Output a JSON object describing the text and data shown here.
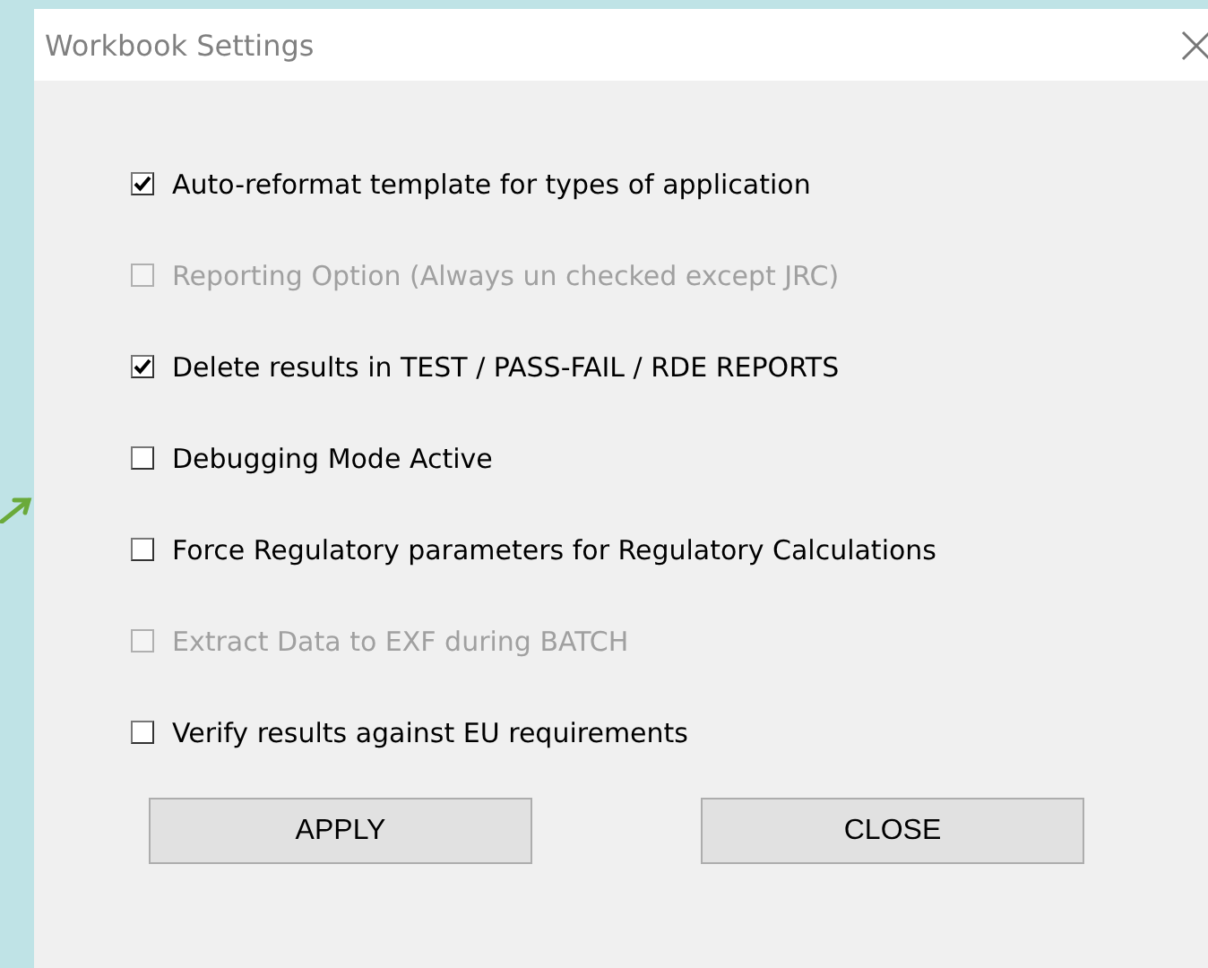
{
  "window": {
    "title": "Workbook Settings"
  },
  "options": [
    {
      "label": "Auto-reformat template for types of application",
      "checked": true,
      "disabled": false
    },
    {
      "label": "Reporting Option (Always un checked except JRC)",
      "checked": false,
      "disabled": true
    },
    {
      "label": "Delete results in TEST / PASS-FAIL / RDE REPORTS",
      "checked": true,
      "disabled": false
    },
    {
      "label": "Debugging Mode Active",
      "checked": false,
      "disabled": false
    },
    {
      "label": "Force Regulatory parameters for Regulatory Calculations",
      "checked": false,
      "disabled": false
    },
    {
      "label": "Extract Data to EXF during BATCH",
      "checked": false,
      "disabled": true
    },
    {
      "label": "Verify results against EU requirements",
      "checked": false,
      "disabled": false
    }
  ],
  "buttons": [
    "APPLY",
    "CLOSE"
  ]
}
